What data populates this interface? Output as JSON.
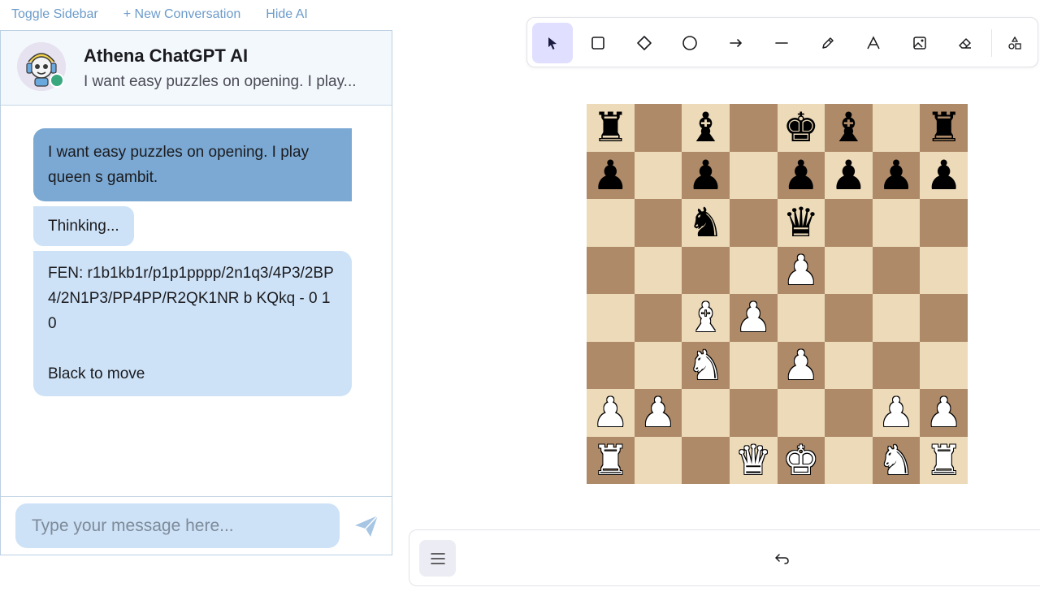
{
  "top_links": {
    "toggle_sidebar": "Toggle Sidebar",
    "new_conversation": "+ New Conversation",
    "hide_ai": "Hide AI"
  },
  "chat": {
    "title": "Athena ChatGPT AI",
    "subtitle": "I want easy puzzles on opening. I play...",
    "avatar_icon": "robot-avatar-icon",
    "status_color": "#3aa87f",
    "messages": [
      {
        "role": "user",
        "text": "I want easy puzzles on opening. I play queen s gambit."
      },
      {
        "role": "assistant",
        "text": "Thinking..."
      },
      {
        "role": "assistant",
        "text": "FEN: r1b1kb1r/p1p1pppp/2n1q3/4P3/2BP4/2N1P3/PP4PP/R2QK1NR b KQkq - 0 10\n\nBlack to move"
      }
    ],
    "input_placeholder": "Type your message here...",
    "send_icon": "send-icon"
  },
  "toolbar": {
    "tools": [
      {
        "name": "selection",
        "icon": "cursor-icon",
        "active": true
      },
      {
        "name": "rectangle",
        "icon": "rectangle-icon"
      },
      {
        "name": "diamond",
        "icon": "diamond-icon"
      },
      {
        "name": "ellipse",
        "icon": "ellipse-icon"
      },
      {
        "name": "arrow",
        "icon": "arrow-icon"
      },
      {
        "name": "line",
        "icon": "line-icon"
      },
      {
        "name": "draw",
        "icon": "pencil-icon"
      },
      {
        "name": "text",
        "icon": "text-icon"
      },
      {
        "name": "image",
        "icon": "image-icon"
      },
      {
        "name": "eraser",
        "icon": "eraser-icon"
      },
      {
        "name": "shapes",
        "icon": "shapes-icon"
      }
    ]
  },
  "board": {
    "ranks": [
      "r.bkb.r",
      "p.p.pppp",
      "..n.q...",
      "....P...",
      "..BP....",
      "..N.P...",
      "PP....PP",
      "R..QK.NR"
    ],
    "ranks_full": [
      [
        "r",
        "",
        "b",
        "",
        "k",
        "b",
        "",
        "r"
      ],
      [
        "p",
        "",
        "p",
        "",
        "p",
        "p",
        "p",
        "p"
      ],
      [
        "",
        "",
        "n",
        "",
        "q",
        "",
        "",
        ""
      ],
      [
        "",
        "",
        "",
        "",
        "P",
        "",
        "",
        ""
      ],
      [
        "",
        "",
        "B",
        "P",
        "",
        "",
        "",
        ""
      ],
      [
        "",
        "",
        "N",
        "",
        "P",
        "",
        "",
        ""
      ],
      [
        "P",
        "P",
        "",
        "",
        "",
        "",
        "P",
        "P"
      ],
      [
        "R",
        "",
        "",
        "Q",
        "K",
        "",
        "N",
        "R"
      ]
    ],
    "light_color": "#ecdab9",
    "dark_color": "#ae8a68"
  },
  "bottom_bar": {
    "menu_icon": "hamburger-menu-icon",
    "undo_icon": "undo-icon"
  }
}
